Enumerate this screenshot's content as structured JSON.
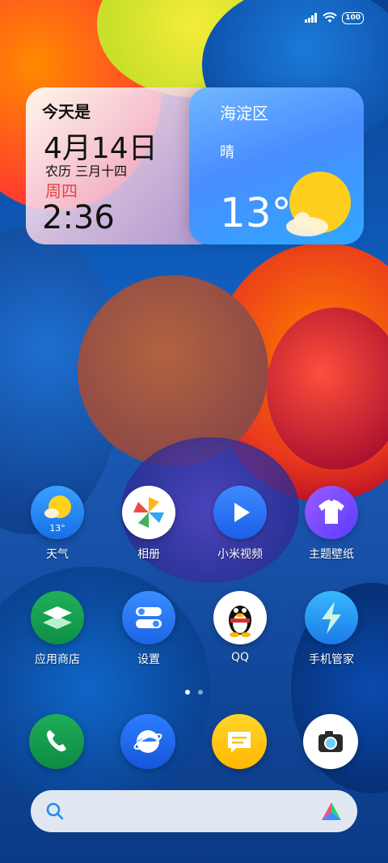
{
  "status": {
    "battery": "100"
  },
  "date_widget": {
    "heading": "今天是",
    "date": "4月14日",
    "lunar": "农历 三月十四",
    "weekday": "周四",
    "time": "2:36"
  },
  "weather_widget": {
    "district": "海淀区",
    "condition": "晴",
    "temperature": "13°"
  },
  "apps_row1": [
    {
      "label": "天气",
      "icon": "weather-icon",
      "temp": "13°"
    },
    {
      "label": "相册",
      "icon": "pinwheel-icon"
    },
    {
      "label": "小米视频",
      "icon": "play-icon"
    },
    {
      "label": "主题壁纸",
      "icon": "tshirt-icon"
    }
  ],
  "apps_row2": [
    {
      "label": "应用商店",
      "icon": "layers-icon"
    },
    {
      "label": "设置",
      "icon": "toggle-icon"
    },
    {
      "label": "QQ",
      "icon": "penguin-icon"
    },
    {
      "label": "手机管家",
      "icon": "lightning-icon"
    }
  ],
  "dock": [
    {
      "icon": "phone-icon"
    },
    {
      "icon": "browser-icon"
    },
    {
      "icon": "message-icon"
    },
    {
      "icon": "camera-icon"
    }
  ],
  "pages": {
    "count": 2,
    "active": 0
  },
  "colors": {
    "weekday_red": "#e8453c",
    "widget_blue": "#4a8dff"
  }
}
